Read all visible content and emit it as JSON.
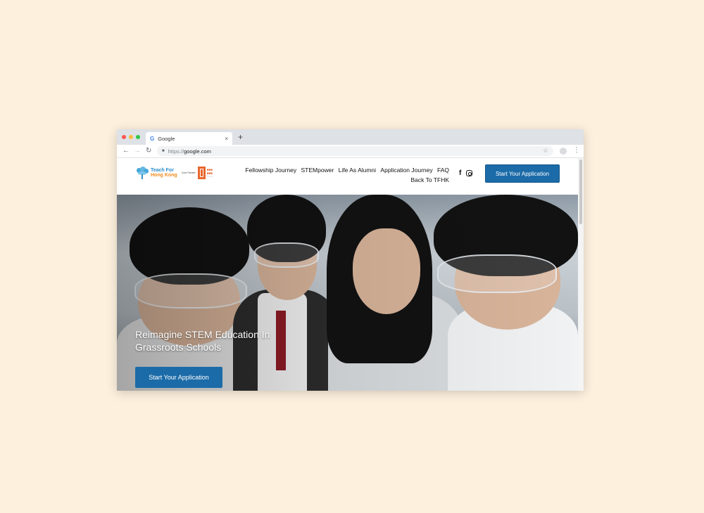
{
  "browser": {
    "tab_title": "Google",
    "tab_favicon": "G",
    "tab_close": "×",
    "new_tab": "+",
    "url_prefix": "https://",
    "url_host": "google.com",
    "icons": [
      "back-icon",
      "forward-icon",
      "reload-icon",
      "lock-icon",
      "star-icon",
      "profile-icon",
      "menu-icon"
    ],
    "dot_colors": [
      "#fc5753",
      "#fdbc40",
      "#33c748"
    ]
  },
  "site": {
    "logo": {
      "name_line1": "Teach For",
      "name_line2": "Hong Kong",
      "core_partner": "Core Partner"
    },
    "nav": [
      "Fellowship Journey",
      "STEMpower",
      "Life As Alumni",
      "Application Journey",
      "FAQ",
      "Back To TFHK"
    ],
    "social": [
      "facebook-icon",
      "instagram-icon"
    ],
    "header_cta": "Start Your Application",
    "accent_color": "#1b6ba8"
  },
  "hero": {
    "title": "Reimagine STEM Education In Grassroots Schools",
    "cta": "Start Your Application"
  }
}
